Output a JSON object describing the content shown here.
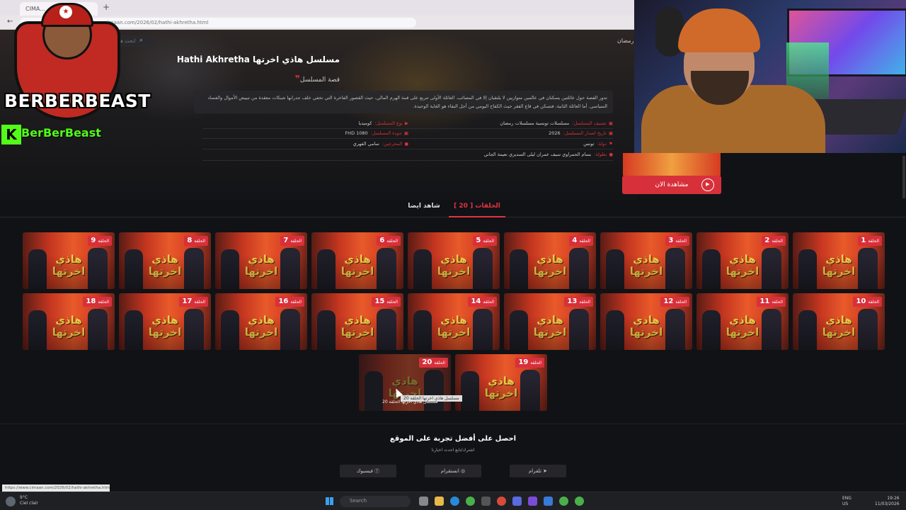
{
  "browser": {
    "tab_title": "CIMA...",
    "new_tab": "+",
    "url": "cimaan.com/2026/02/hathi-akhretha.html"
  },
  "header": {
    "search_placeholder": "ابحث هنا",
    "nav_item": "رمضان"
  },
  "series": {
    "title": "مسلسل هاذي اخرتها Hathi Akhretha",
    "story_heading": "قصة المسلسل",
    "story": "تدور القصة حول عائلتين يسكنان في عالمين متوازيين لا يلتقيان إلا في المصائب. العائلة الأولى تتربع على قمة الهرم المالي، حيث القصور الفاخرة التي تخفي خلف جدرانها شبكات معقدة من تبييض الأموال والفساد السياسي. أما العائلة الثانية، فتسكن في قاع الفقر حيث الكفاح اليومي من أجل البقاء هو الغاية الوحيدة.",
    "meta": {
      "category_label": "تصنيف المسلسل:",
      "category_value": "مسلسلات تونسية  مسلسلات رمضان",
      "type_label": "نوع المسلسل:",
      "type_value": "كوميديا",
      "year_label": "تاريخ اصدار المسلسل:",
      "year_value": "2026",
      "quality_label": "جودة المسلسل:",
      "quality_value": "FHD 1080",
      "country_label": "دولة:",
      "country_value": "تونس",
      "director_label": "المخرجين:",
      "director_value": "سامي الفهري",
      "cast_label": "بطولة:",
      "cast_value": "بسام الحمراوي   سيف عمران   ليلى السديري   نعيمة الجاني"
    },
    "watch_now": "مشاهدة الان"
  },
  "tabs": {
    "episodes": "الحلقات [ 20 ]",
    "watch_also": "شاهد ايضا"
  },
  "episodes": {
    "badge_label": "الحلقة",
    "logo_text": "هاذي اخرتها",
    "row1": [
      "9",
      "8",
      "7",
      "6",
      "5",
      "4",
      "3",
      "2",
      "1"
    ],
    "row2": [
      "18",
      "17",
      "16",
      "15",
      "14",
      "13",
      "12",
      "11",
      "10"
    ],
    "row3": [
      "20",
      "19"
    ],
    "hover_caption": "مسلسل هاذي اخرتها الحلقة 20",
    "tooltip": "مسلسل هاذي اخرتها الحلقة 20"
  },
  "footer": {
    "title": "احصل على أفضل تجربة على الموقع",
    "subtitle": "اشترك/تابع احدث اخبارنا",
    "facebook": "فيسبوك",
    "instagram": "انستقرام",
    "telegram": "تلقرام",
    "status_url": "https://www.cimaan.com/2026/02/hathi-akhretha.html#"
  },
  "taskbar": {
    "temp": "9°C",
    "weather": "Ciel clair",
    "search": "Search",
    "lang": "ENG",
    "lang_sub": "US",
    "time": "19:26",
    "date": "11/03/2026"
  },
  "overlay": {
    "brand": "BERBERBEAST",
    "kick_letter": "K",
    "kick_name": "BerBerBeast"
  },
  "colors": {
    "accent": "#d7303b",
    "kick_green": "#53fc18"
  }
}
